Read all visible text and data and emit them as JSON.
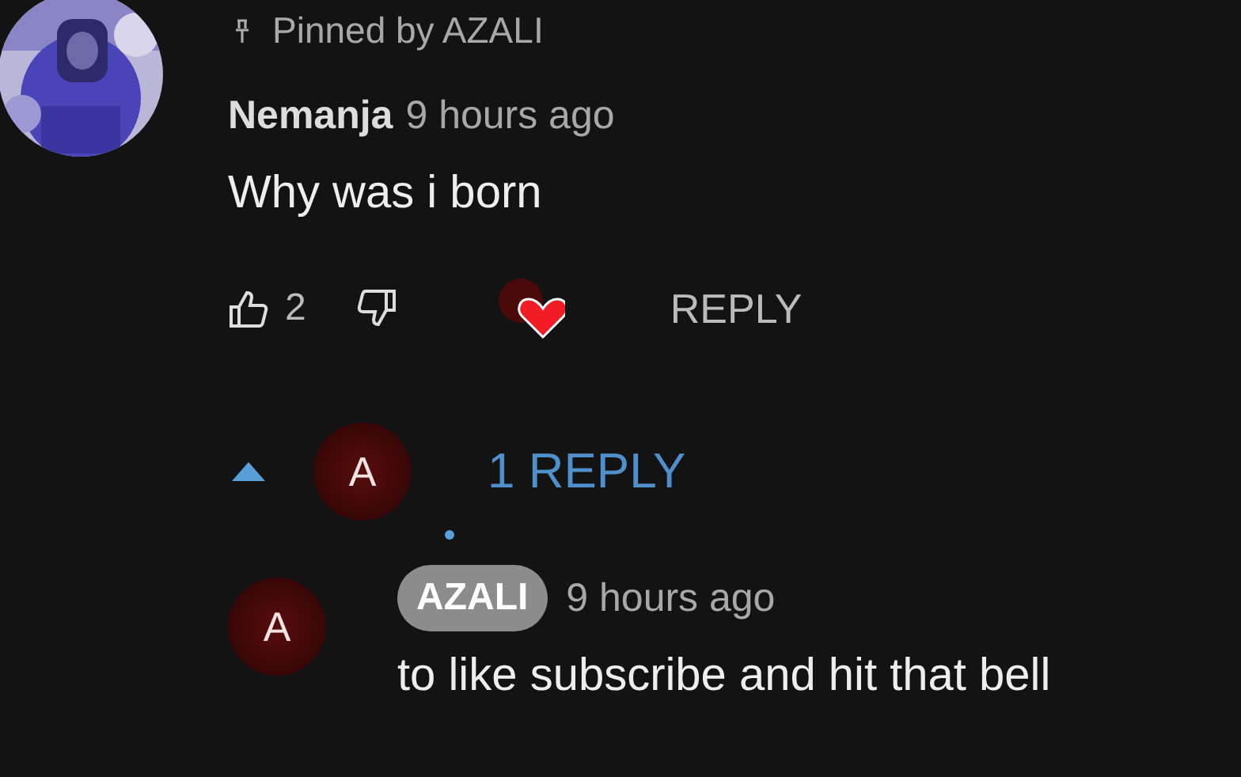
{
  "pinned": {
    "text": "Pinned by AZALI"
  },
  "comment": {
    "author": "Nemanja",
    "time": "9 hours ago",
    "text": "Why was i born",
    "likes": "2",
    "hearted": true,
    "reply_button": "REPLY"
  },
  "replies": {
    "expanded": true,
    "toggle_label": "1 REPLY",
    "toggle_avatar": "A",
    "items": [
      {
        "avatar": "A",
        "author": "AZALI",
        "is_creator": true,
        "time": "9 hours ago",
        "text": "to like subscribe and hit that bell"
      }
    ]
  }
}
